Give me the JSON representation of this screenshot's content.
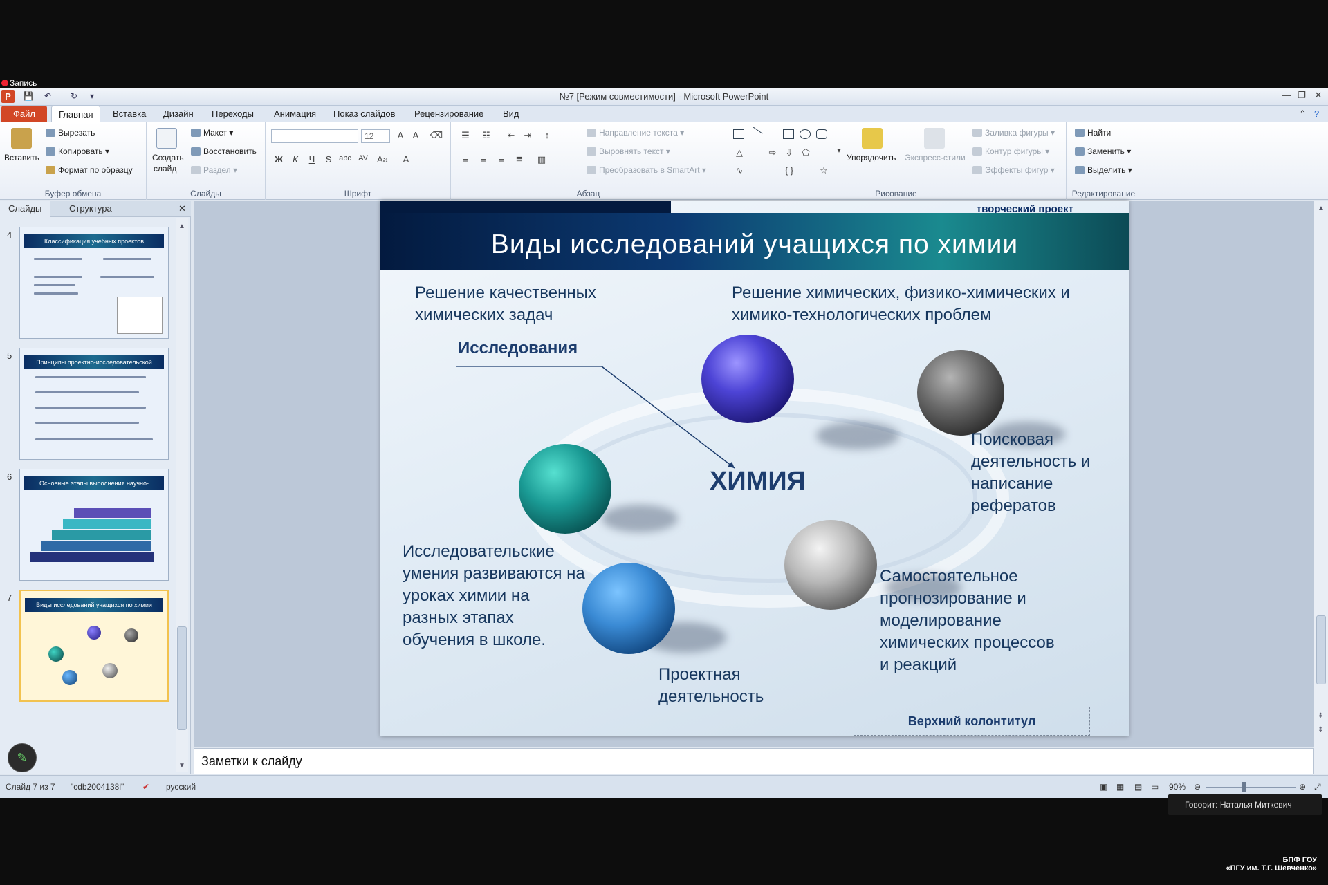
{
  "recording_label": "Запись",
  "window": {
    "title": "№7 [Режим совместимости] - Microsoft PowerPoint",
    "app_icon": "P"
  },
  "tabs": [
    "Файл",
    "Главная",
    "Вставка",
    "Дизайн",
    "Переходы",
    "Анимация",
    "Показ слайдов",
    "Рецензирование",
    "Вид"
  ],
  "ribbon": {
    "clipboard": {
      "label": "Буфер обмена",
      "paste": "Вставить",
      "cut": "Вырезать",
      "copy": "Копировать",
      "format_painter": "Формат по образцу"
    },
    "slides": {
      "label": "Слайды",
      "new_slide_1": "Создать",
      "new_slide_2": "слайд",
      "layout": "Макет",
      "reset": "Восстановить",
      "section": "Раздел"
    },
    "font": {
      "label": "Шрифт",
      "font_size": "12"
    },
    "paragraph": {
      "label": "Абзац",
      "text_direction": "Направление текста",
      "align_text": "Выровнять текст",
      "smartart": "Преобразовать в SmartArt"
    },
    "drawing": {
      "label": "Рисование",
      "arrange": "Упорядочить",
      "quick_styles": "Экспресс-стили",
      "shape_fill": "Заливка фигуры",
      "shape_outline": "Контур фигуры",
      "shape_effects": "Эффекты фигур"
    },
    "editing": {
      "label": "Редактирование",
      "find": "Найти",
      "replace": "Заменить",
      "select": "Выделить"
    }
  },
  "panel": {
    "tabs": [
      "Слайды",
      "Структура"
    ],
    "thumbs": [
      {
        "num": "4",
        "title": "Классификация учебных проектов исследовательских работ"
      },
      {
        "num": "5",
        "title": "Принципы проектно-исследовательской деятельности"
      },
      {
        "num": "6",
        "title": "Основные этапы выполнения научно-исследовательских работ учащихся"
      },
      {
        "num": "7",
        "title": "Виды исследований учащихся по химии"
      }
    ]
  },
  "slide": {
    "creative": "творческий проект",
    "title": "Виды исследований учащихся по химии",
    "tl": "Решение качественных химических задач",
    "tr": "Решение химических, физико-химических и химико-технологических проблем",
    "research": "Исследования",
    "center": "ХИМИЯ",
    "r1": "Поисковая деятельность и написание рефератов",
    "l1": "Исследовательские умения развиваются на уроках химии на разных этапах обучения в школе.",
    "r2": "Самостоятельное прогнозирование и моделирование химических процессов и реакций",
    "b1": "Проектная деятельность",
    "header": "Верхний колонтитул"
  },
  "notes": "Заметки к слайду",
  "status": {
    "slide": "Слайд 7 из 7",
    "theme": "\"cdb2004138l\"",
    "lang": "русский",
    "zoom": "90%"
  },
  "speaker": "Говорит: Наталья Миткевич",
  "watermark": {
    "l1": "БПФ ГОУ",
    "l2": "«ПГУ им. Т.Г. Шевченко»"
  },
  "colors": {
    "file_tab": "#d24726",
    "slide_band": "#0c3a72",
    "slide_text": "#17375e"
  }
}
